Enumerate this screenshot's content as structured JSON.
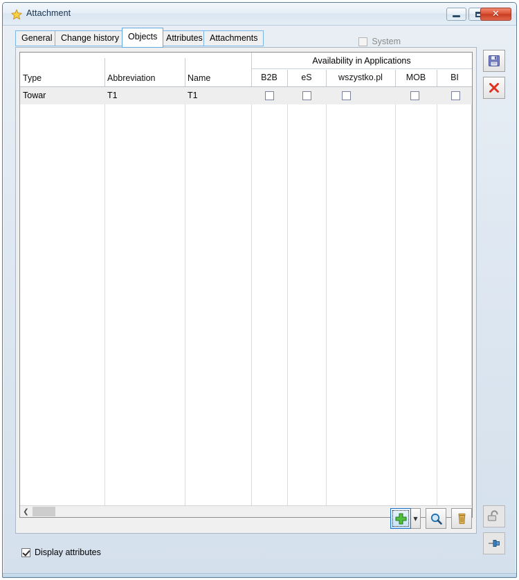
{
  "window": {
    "title": "Attachment",
    "icon": "star-icon",
    "caption_buttons": {
      "minimize": "minimize-icon",
      "maximize": "maximize-icon",
      "close": "✕"
    }
  },
  "tabs": [
    {
      "label": "General",
      "active": false
    },
    {
      "label": "Change history",
      "active": false
    },
    {
      "label": "Objects",
      "active": true
    },
    {
      "label": "Attributes",
      "active": false
    },
    {
      "label": "Attachments",
      "active": false
    }
  ],
  "system_checkbox": {
    "label": "System",
    "checked": false,
    "enabled": false
  },
  "grid": {
    "group_header": "Availability in Applications",
    "columns": [
      {
        "key": "type",
        "label": "Type"
      },
      {
        "key": "abbreviation",
        "label": "Abbreviation"
      },
      {
        "key": "name",
        "label": "Name"
      },
      {
        "key": "b2b",
        "label": "B2B"
      },
      {
        "key": "es",
        "label": "eS"
      },
      {
        "key": "wszystko",
        "label": "wszystko.pl"
      },
      {
        "key": "mob",
        "label": "MOB"
      },
      {
        "key": "bi",
        "label": "BI"
      }
    ],
    "rows": [
      {
        "type": "Towar",
        "abbreviation": "T1",
        "name": "T1",
        "b2b": false,
        "es": false,
        "wszystko": false,
        "mob": false,
        "bi": false,
        "selected": true
      }
    ],
    "scrollbar": {
      "left_arrow": "❮",
      "right_arrow": "❯"
    }
  },
  "toolbar": {
    "add_label": "add-button",
    "add_dropdown_label": "▼",
    "search_label": "search-button",
    "delete_label": "delete-button"
  },
  "display_attributes": {
    "label": "Display attributes",
    "checked": true
  },
  "side_buttons": {
    "save": "save-button",
    "cancel": "cancel-button",
    "lock": "lock-button",
    "pin": "pin-button"
  },
  "colors": {
    "accent": "#77b5e8",
    "close": "#c83c22",
    "selected_row": "#eeeeee",
    "add_green": "#3faa38",
    "delete_orange": "#d9a441"
  }
}
